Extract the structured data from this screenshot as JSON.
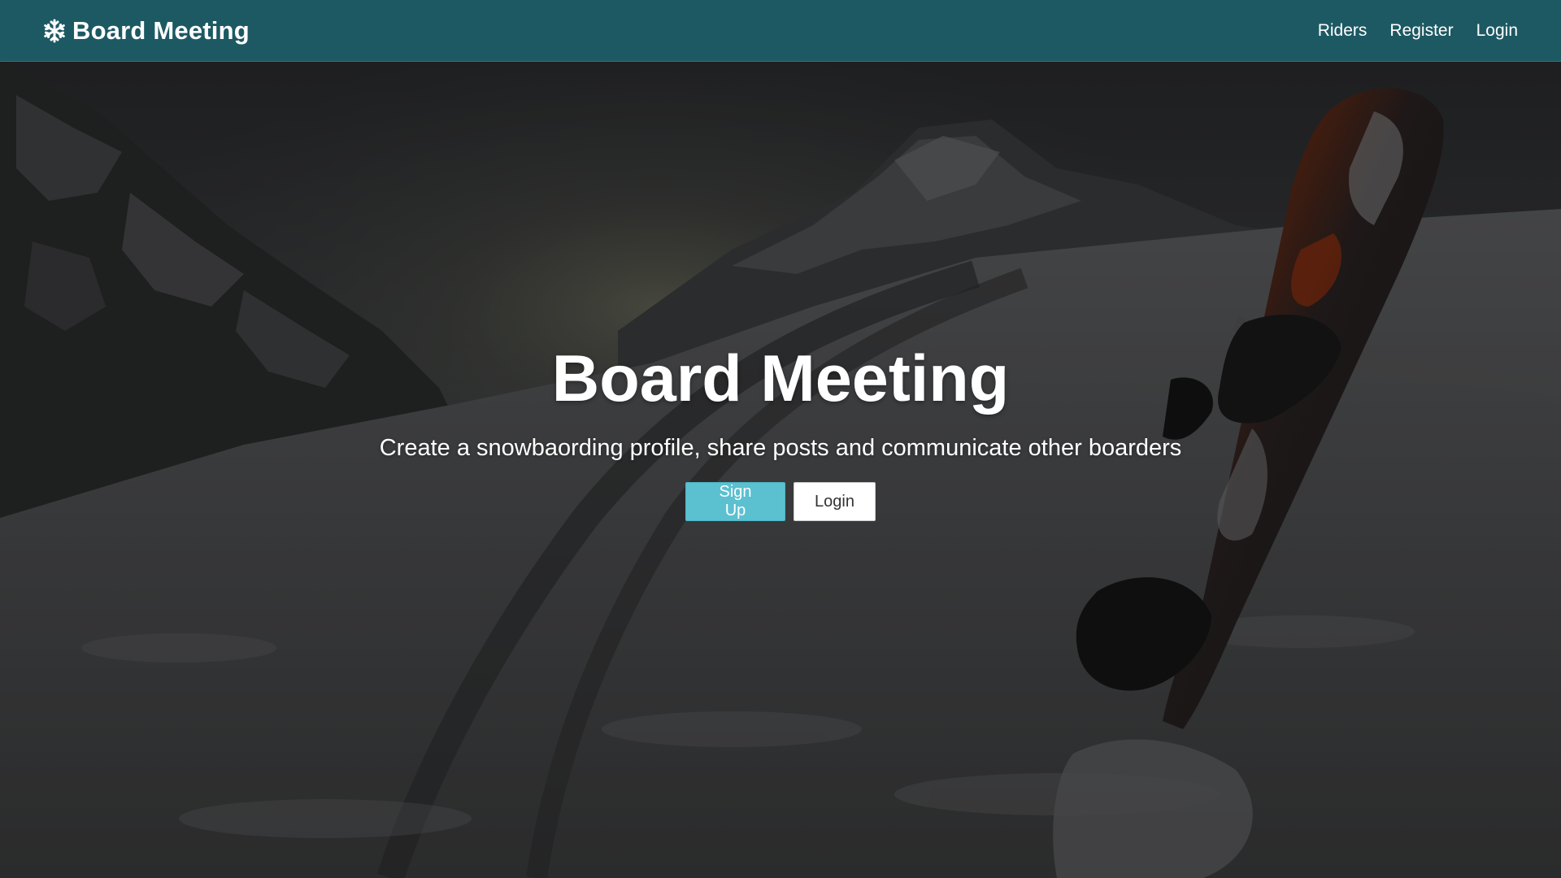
{
  "navbar": {
    "brand": "Board Meeting",
    "brand_icon": "snowflake-icon",
    "links": [
      "Riders",
      "Register",
      "Login"
    ],
    "background_color": "#1d5963"
  },
  "hero": {
    "title": "Board Meeting",
    "subtitle": "Create a snowbaording profile, share posts and communicate other boarders",
    "buttons": {
      "signup": "Sign Up",
      "login": "Login"
    },
    "colors": {
      "signup_bg": "#5bc0d0",
      "login_bg": "#ffffff"
    }
  }
}
